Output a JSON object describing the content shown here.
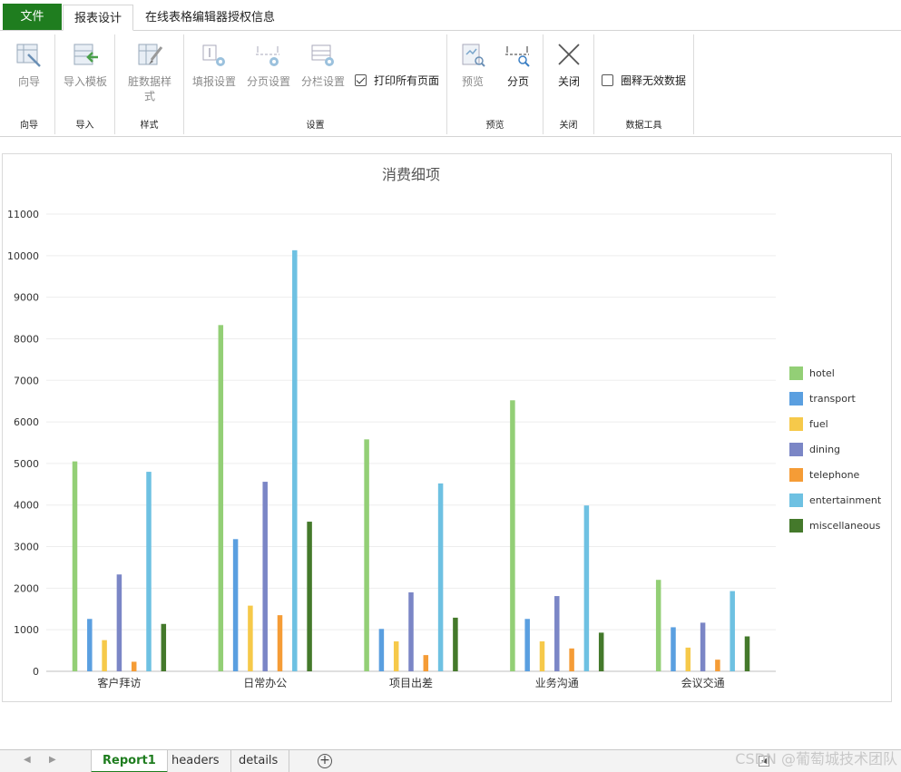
{
  "tabs": {
    "file": "文件",
    "report_design": "报表设计",
    "license_info": "在线表格编辑器授权信息"
  },
  "ribbon": {
    "groups": {
      "wizard": {
        "label": "向导",
        "btn": "向导"
      },
      "import": {
        "label": "导入",
        "btn": "导入模板"
      },
      "style": {
        "label": "样式",
        "btn_line1": "脏数据样",
        "btn_line2": "式"
      },
      "settings": {
        "label": "设置",
        "fill": "填报设置",
        "page": "分页设置",
        "column": "分栏设置",
        "print_all": "打印所有页面"
      },
      "preview": {
        "label": "预览",
        "preview": "预览",
        "paging": "分页"
      },
      "close": {
        "label": "关闭",
        "btn": "关闭"
      },
      "data_tools": {
        "label": "数据工具",
        "circle_invalid": "圈释无效数据"
      }
    }
  },
  "chart_data": {
    "type": "bar",
    "title": "消费细项",
    "categories": [
      "客户拜访",
      "日常办公",
      "项目出差",
      "业务沟通",
      "会议交通"
    ],
    "ylim": [
      0,
      11000
    ],
    "yticks": [
      0,
      1000,
      2000,
      3000,
      4000,
      5000,
      6000,
      7000,
      8000,
      9000,
      10000,
      11000
    ],
    "grid": true,
    "legend_position": "right",
    "series": [
      {
        "name": "hotel",
        "color": "#93cf76",
        "values": [
          5050,
          8330,
          5580,
          6520,
          2200
        ]
      },
      {
        "name": "transport",
        "color": "#5a9fe0",
        "values": [
          1260,
          3180,
          1020,
          1260,
          1060
        ]
      },
      {
        "name": "fuel",
        "color": "#f6c94a",
        "values": [
          750,
          1580,
          720,
          720,
          570
        ]
      },
      {
        "name": "dining",
        "color": "#7b86c6",
        "values": [
          2330,
          4560,
          1900,
          1810,
          1170
        ]
      },
      {
        "name": "telephone",
        "color": "#f59c36",
        "values": [
          230,
          1350,
          390,
          550,
          280
        ]
      },
      {
        "name": "entertainment",
        "color": "#6ec1e2",
        "values": [
          4800,
          10130,
          4520,
          3990,
          1930
        ]
      },
      {
        "name": "miscellaneous",
        "color": "#44792b",
        "values": [
          1140,
          3600,
          1290,
          930,
          840
        ]
      }
    ]
  },
  "sheets": {
    "report1": "Report1",
    "headers": "headers",
    "details": "details",
    "add": "+"
  },
  "watermark": "CSDN @葡萄城技术团队",
  "colors": {
    "accent": "#1f7d1f"
  }
}
